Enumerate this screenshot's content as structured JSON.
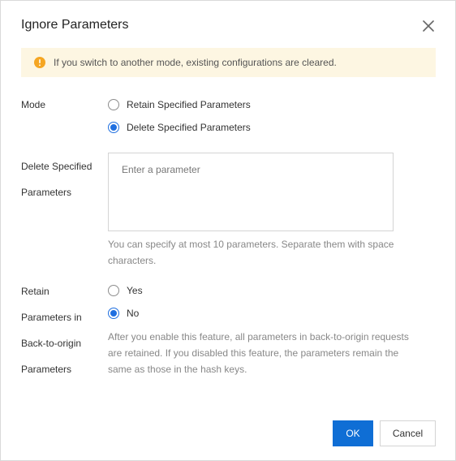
{
  "dialog": {
    "title": "Ignore Parameters"
  },
  "icons": {
    "close": "close-icon",
    "warning": "warning-icon"
  },
  "banner": {
    "text": "If you switch to another mode, existing configurations are cleared.",
    "background": "#fdf6e2",
    "icon_color": "#f5a623"
  },
  "mode": {
    "label": "Mode",
    "options": [
      {
        "label": "Retain Specified Parameters",
        "checked": false
      },
      {
        "label": "Delete Specified Parameters",
        "checked": true
      }
    ]
  },
  "delete_params": {
    "label_line1": "Delete Specified",
    "label_line2": "Parameters",
    "placeholder": "Enter a parameter",
    "value": "",
    "help_line1": "You can specify at most 10 parameters. Separate them with space",
    "help_line2": "characters."
  },
  "retain_back_to_origin": {
    "label_line1": "Retain",
    "label_line2": "Parameters in",
    "label_line3": "Back-to-origin",
    "label_line4": "Parameters",
    "options": [
      {
        "label": "Yes",
        "checked": false
      },
      {
        "label": "No",
        "checked": true
      }
    ],
    "help_line1": "After you enable this feature, all parameters in back-to-origin requests",
    "help_line2": "are retained. If you disabled this feature, the parameters remain the",
    "help_line3": "same as those in the hash keys."
  },
  "footer": {
    "ok_label": "OK",
    "cancel_label": "Cancel"
  },
  "colors": {
    "primary": "#0f6ed5",
    "radio_checked": "#1f6fe0",
    "help_text": "#888888"
  }
}
